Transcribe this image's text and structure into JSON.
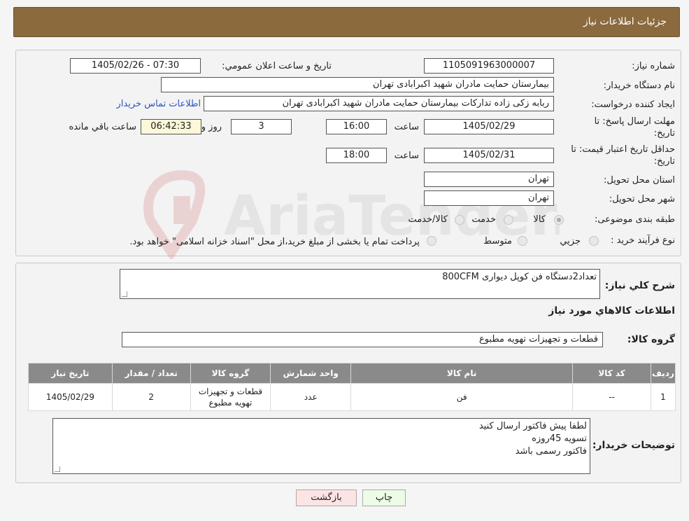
{
  "header": {
    "title": "جزئیات اطلاعات نیاز"
  },
  "form": {
    "need_number_label": "شماره نیاز:",
    "need_number": "1105091963000007",
    "announce_label": "تاریخ و ساعت اعلان عمومي:",
    "announce_value": "1405/02/26 - 07:30",
    "buyer_org_label": "نام دستگاه خریدار:",
    "buyer_org": "بیمارستان حمایت مادران شهید اکبرابادی تهران",
    "creator_label": "ایجاد کننده درخواست:",
    "creator": "ربابه  زکی زاده تدارکات بیمارستان حمایت مادران شهید اکبرابادی تهران",
    "contact_link": "اطلاعات تماس خریدار",
    "send_deadline_label_1": "مهلت ارسال پاسخ: تا",
    "send_deadline_label_2": "تاریخ:",
    "send_deadline_date": "1405/02/29",
    "time_label": "ساعت",
    "send_deadline_time": "16:00",
    "days_value": "3",
    "days_label": "روز و",
    "remaining_time": "06:42:33",
    "remaining_label": "ساعت باقي مانده",
    "price_validity_label_1": "حداقل تاریخ اعتبار قیمت: تا",
    "price_validity_label_2": "تاریخ:",
    "price_validity_date": "1405/02/31",
    "price_validity_time": "18:00",
    "province_label": "استان محل تحویل:",
    "province": "تهران",
    "city_label": "شهر محل تحویل:",
    "city": "تهران",
    "category_label": "طبقه بندی موضوعی:",
    "category_options": [
      "کالا",
      "خدمت",
      "کالا/خدمت"
    ],
    "category_selected": "کالا",
    "process_label": "نوع فرآیند خرید :",
    "process_options": [
      "جزيي",
      "متوسط"
    ],
    "process_note": "پرداخت تمام یا بخشی از مبلغ خرید،از محل \"اسناد خزانه اسلامی\" خواهد بود."
  },
  "details": {
    "description_label": "شرح کلي نیاز:",
    "description": "تعداد2دستگاه فن کوپل دیواری  800CFM",
    "goods_info_title": "اطلاعات کالاهاي مورد نیاز",
    "goods_group_label": "گروه کالا:",
    "goods_group": "قطعات و تجهیزات تهویه مطبوع",
    "table": {
      "headers": [
        "ردیف",
        "کد کالا",
        "نام کالا",
        "واحد شمارش",
        "گروه کالا",
        "تعداد / مقدار",
        "تاریخ نیاز"
      ],
      "rows": [
        [
          "1",
          "--",
          "فن",
          "عدد",
          "قطعات و تجهیزات تهویه مطبوع",
          "2",
          "1405/02/29"
        ]
      ]
    },
    "buyer_notes_label": "توضیحات خریدار:",
    "buyer_notes": [
      "لطفا پیش فاکتور ارسال کنید",
      "تسویه 45روزه",
      "فاکتور رسمی باشد"
    ]
  },
  "buttons": {
    "print": "چاپ",
    "back": "بازگشت"
  },
  "watermark": {
    "text": "AriaTender.neT"
  },
  "colors": {
    "header": "#8b6a3e",
    "link": "#2a55c8",
    "print_button": "#eefbe6",
    "back_button": "#fde4e4",
    "table_header": "#8a8a8a"
  }
}
